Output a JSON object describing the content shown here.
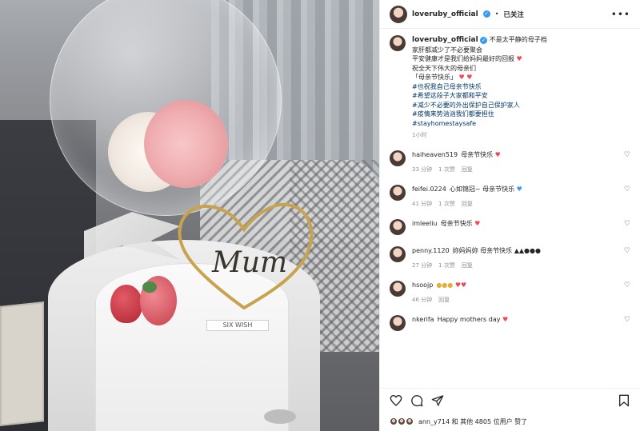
{
  "post": {
    "author": "loveruby_official",
    "follow_label": "已关注",
    "caption_lines": [
      "不是太平静的母子档",
      "家肝都减少了不必要聚会",
      "平安健康才是我们给妈妈最好的回报",
      "祝全天下伟大的母亲们",
      "「母亲节快乐」",
      "#也祝我自己母亲节快乐",
      "#希望这段子大家都和平安",
      "#减少不必要的外出保护自己保护家人",
      "#疫情来势汹汹我们都要担住",
      "#stayhomestaysafe"
    ],
    "caption_time": "1小时",
    "comments": [
      {
        "user": "haiheaven519",
        "text": "母亲节快乐",
        "time": "33 分钟",
        "likes": "1 次赞",
        "reply": "回复"
      },
      {
        "user": "feifei.0224",
        "text": "心如锦冠~ 母亲节快乐",
        "time": "41 分钟",
        "likes": "1 次赞",
        "reply": "回复"
      },
      {
        "user": "imleeliu",
        "text": "母亲节快乐",
        "time": "",
        "likes": "",
        "reply": ""
      },
      {
        "user": "penny.1120",
        "text": "妳妈妈妳 母亲节快乐",
        "time": "27 分钟",
        "likes": "1 次赞",
        "reply": "回复"
      },
      {
        "user": "hsoojp",
        "text": "",
        "time": "46 分钟",
        "likes": "",
        "reply": "回复"
      },
      {
        "user": "nkerifa",
        "text": "Happy mothers day",
        "time": "",
        "likes": "",
        "reply": ""
      }
    ],
    "likes_text": "ann_y714 和 其他 4805 位用户 赞了",
    "colors": {
      "heart_red": "#ed4956",
      "verified_blue": "#3897f0",
      "text_main": "#262626",
      "text_muted": "#8e8e8e"
    },
    "icons": [
      "more-icon",
      "heart-icon",
      "comment-icon",
      "share-icon",
      "bookmark-icon",
      "verified-icon"
    ]
  },
  "photo": {
    "topper_text": "Mum",
    "label_text": "SIX WISH"
  }
}
